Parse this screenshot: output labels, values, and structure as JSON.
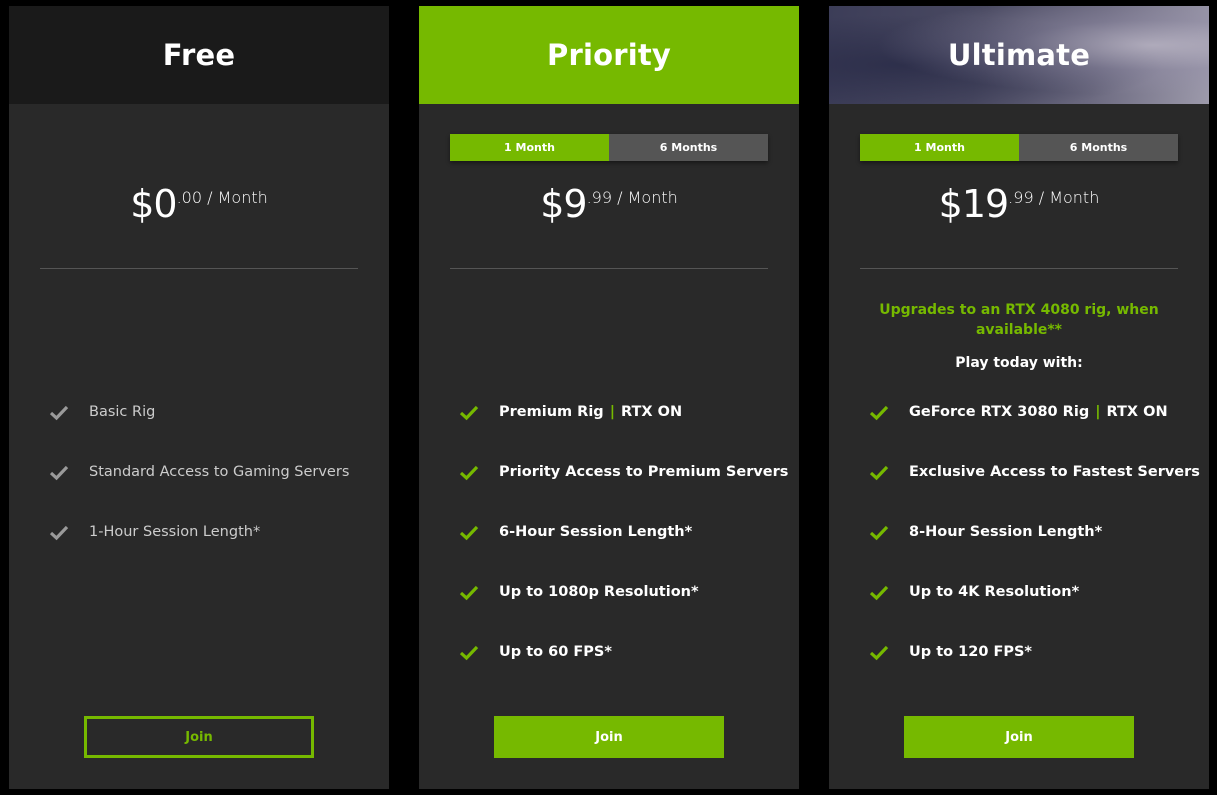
{
  "colors": {
    "accent": "#76b900",
    "card_bg": "#292929",
    "page_bg": "#000000",
    "toggle_inactive": "#555555"
  },
  "plans": [
    {
      "name": "Free",
      "price": {
        "dollars": "$0",
        "cents": ".00",
        "period": " / Month"
      },
      "features": [
        {
          "text": "Basic Rig",
          "suffix": ""
        },
        {
          "text": "Standard Access to Gaming Servers",
          "suffix": ""
        },
        {
          "text": "1-Hour Session Length*",
          "suffix": ""
        }
      ],
      "join_label": "Join"
    },
    {
      "name": "Priority",
      "toggle": {
        "options": [
          "1 Month",
          "6 Months"
        ],
        "selected": "1 Month"
      },
      "price": {
        "dollars": "$9",
        "cents": ".99",
        "period": " / Month"
      },
      "features": [
        {
          "text": "Premium Rig",
          "separator": "|",
          "suffix": "RTX ON"
        },
        {
          "text": "Priority Access to Premium Servers",
          "suffix": ""
        },
        {
          "text": "6-Hour Session Length*",
          "suffix": ""
        },
        {
          "text": "Up to 1080p Resolution*",
          "suffix": ""
        },
        {
          "text": "Up to 60 FPS*",
          "suffix": ""
        }
      ],
      "join_label": "Join"
    },
    {
      "name": "Ultimate",
      "toggle": {
        "options": [
          "1 Month",
          "6 Months"
        ],
        "selected": "1 Month"
      },
      "price": {
        "dollars": "$19",
        "cents": ".99",
        "period": " / Month"
      },
      "upgrade_note": "Upgrades to an RTX 4080 rig, when available**",
      "play_today": "Play today with:",
      "features": [
        {
          "text": "GeForce RTX 3080 Rig",
          "separator": "|",
          "suffix": "RTX ON"
        },
        {
          "text": "Exclusive Access to Fastest Servers",
          "suffix": ""
        },
        {
          "text": "8-Hour Session Length*",
          "suffix": ""
        },
        {
          "text": "Up to 4K Resolution*",
          "suffix": ""
        },
        {
          "text": "Up to 120 FPS*",
          "suffix": ""
        }
      ],
      "join_label": "Join"
    }
  ],
  "icons": {
    "feature_bullet": "check-icon"
  }
}
